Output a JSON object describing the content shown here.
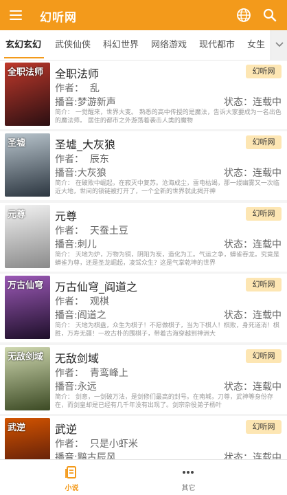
{
  "app": {
    "title": "幻听网"
  },
  "header": {
    "menu_icon": "menu-icon",
    "globe_icon": "globe-icon",
    "search_icon": "search-icon",
    "accent": "#f39a1b"
  },
  "tabs": [
    {
      "label": "玄幻玄幻"
    },
    {
      "label": "武侠仙侠"
    },
    {
      "label": "科幻世界"
    },
    {
      "label": "网络游戏"
    },
    {
      "label": "现代都市"
    },
    {
      "label": "女生"
    }
  ],
  "books": [
    {
      "name": "全职法师",
      "badge": "幻听网",
      "author": "作者：  乱",
      "narrator": "播音:梦游新声",
      "status": "状态：连载中",
      "intro": "简介：  一觉醒来，世界大变。    熟悉的高中传授的是魔法，告诉大家要成为一名出色的魔法师。  居住的都市之外游荡着袭击人类的魔物",
      "cover_text": "全职法师",
      "cover_color": "#7a1f22"
    },
    {
      "name": "圣墟_大灰狼",
      "badge": "幻听网",
      "author": "作者：  辰东",
      "narrator": "播音:大灰狼",
      "status": "状态：连载中",
      "intro": "简介：  在破败中崛起，在寂灭中复苏。沧海成尘，雷电枯竭，那一缕幽雾又一次临近大地，世间的锁链被打开了，一个全新的世界就此揭开神",
      "cover_text": "圣墟",
      "cover_color": "#3a4a55"
    },
    {
      "name": "元尊",
      "badge": "幻听网",
      "author": "作者：  天蚕土豆",
      "narrator": "播音:刺儿",
      "status": "状态：连载中",
      "intro": "简介：  天地为炉，万物为铜，阴阳为炭，造化为工。气运之争，蟒雀吞龙。究竟是蟒雀为尊，还是圣龙崛起，凌驾众生？这是气掌乾坤的世界",
      "cover_text": "元尊",
      "cover_color": "#e8e8e8"
    },
    {
      "name": "万古仙穹_阎道之",
      "badge": "幻听网",
      "author": "作者：  观棋",
      "narrator": "播音:阎道之",
      "status": "状态：连载中",
      "intro": "简介：  天地为棋盘，众生为棋子！不愿做棋子，当为下棋人！棋败，身死道消！棋胜，万寿无疆！一枚古朴的围棋子，带着古海穿越到神洲大",
      "cover_text": "万古仙穹",
      "cover_color": "#4a2a5a"
    },
    {
      "name": "无敌剑域",
      "badge": "幻听网",
      "author": "作者：  青鸾峰上",
      "narrator": "播音:永远",
      "status": "状态：连载中",
      "intro": "简介：  剑意，一剑破万法，是剑修们最高的封号。在南城，刀尊，武神等身份存在，而剑皇却是已经有几千年没有出现了。剑宗杂役弟子杨叶",
      "cover_text": "无敌剑域",
      "cover_color": "#5b6e3a"
    },
    {
      "name": "武逆",
      "badge": "幻听网",
      "author": "作者：  只是小虾米",
      "narrator": "播音:黯古辰风",
      "status": "状态：连载中",
      "intro": "",
      "cover_text": "武逆",
      "cover_color": "#6e1a1a"
    }
  ],
  "bottom_nav": [
    {
      "label": "小说",
      "icon": "book-icon"
    },
    {
      "label": "其它",
      "icon": "more-icon"
    }
  ]
}
